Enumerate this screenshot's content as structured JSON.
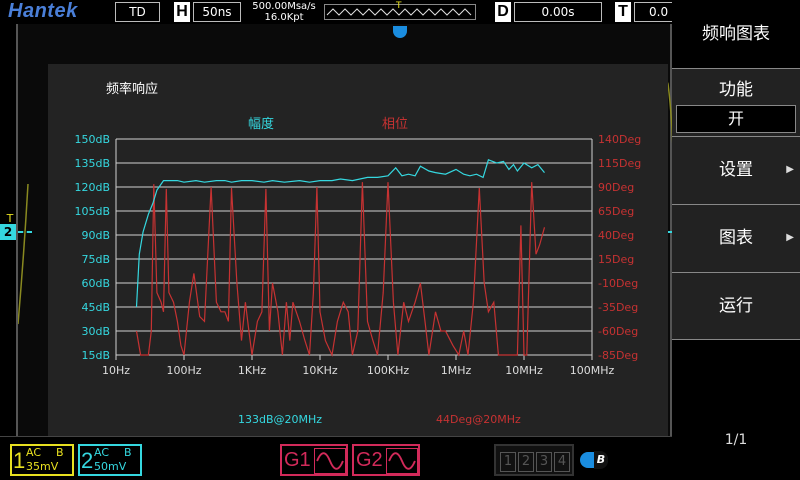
{
  "topbar": {
    "logo": "Hantek",
    "mode": "TD",
    "h_label": "H",
    "timebase": "50ns",
    "sample_rate": "500.00Msa/s",
    "memory": "16.0Kpt",
    "trigger_marker": "T",
    "d_label": "D",
    "delay": "0.00s",
    "t_label": "T",
    "trigger_level": "0.0"
  },
  "menu": {
    "title": "频响图表",
    "function_label": "功能",
    "function_value": "开",
    "settings_label": "设置",
    "chart_label": "图表",
    "run_label": "运行",
    "page": "1/1"
  },
  "trigger_side_label": "T",
  "channel_side_label": "2",
  "colors": {
    "amplitude": "#35d8e0",
    "phase": "#c63232",
    "grid": "#d0d0d0",
    "ch1": "#e8e020",
    "ch2": "#35d8e0",
    "gen": "#d22a5a"
  },
  "chart_data": {
    "type": "line",
    "title": "频率响应",
    "x_scale": "log",
    "x_ticks": [
      "10Hz",
      "100Hz",
      "1KHz",
      "10KHz",
      "100KHz",
      "1MHz",
      "10MHz",
      "100MHz"
    ],
    "xlim": [
      10,
      100000000
    ],
    "y_left_ticks": [
      "150dB",
      "135dB",
      "120dB",
      "105dB",
      "90dB",
      "75dB",
      "60dB",
      "45dB",
      "30dB",
      "15dB"
    ],
    "y_right_ticks": [
      "140Deg",
      "115Deg",
      "90Deg",
      "65Deg",
      "40Deg",
      "15Deg",
      "-10Deg",
      "-35Deg",
      "-60Deg",
      "-85Deg"
    ],
    "y_left_lim": [
      15,
      150
    ],
    "y_right_lim": [
      -85,
      140
    ],
    "grid": true,
    "series": [
      {
        "name": "幅度",
        "axis": "left",
        "x": [
          20,
          22,
          25,
          30,
          35,
          40,
          50,
          60,
          80,
          100,
          150,
          200,
          300,
          400,
          500,
          700,
          1000,
          1500,
          2000,
          3000,
          5000,
          7000,
          10000,
          15000,
          20000,
          30000,
          50000,
          70000,
          100000,
          130000,
          160000,
          200000,
          250000,
          300000,
          400000,
          500000,
          700000,
          1000000,
          1300000,
          1600000,
          2000000,
          2500000,
          3000000,
          4000000,
          5000000,
          6000000,
          7000000,
          8000000,
          10000000,
          13000000,
          16000000,
          20000000
        ],
        "values": [
          45,
          78,
          92,
          103,
          110,
          118,
          124,
          124,
          124,
          123,
          124,
          123,
          124,
          124,
          123,
          124,
          124,
          123,
          124,
          123,
          124,
          123,
          124,
          124,
          125,
          124,
          126,
          126,
          127,
          132,
          127,
          128,
          127,
          133,
          130,
          129,
          128,
          131,
          128,
          127,
          128,
          126,
          137,
          135,
          136,
          131,
          134,
          130,
          135,
          132,
          134,
          129
        ]
      },
      {
        "name": "相位",
        "axis": "right",
        "x": [
          20,
          23,
          26,
          30,
          33,
          36,
          40,
          46,
          50,
          55,
          60,
          70,
          80,
          90,
          100,
          120,
          140,
          170,
          200,
          250,
          300,
          350,
          400,
          450,
          500,
          600,
          700,
          800,
          900,
          1000,
          1200,
          1400,
          1600,
          1800,
          2000,
          2400,
          2800,
          3200,
          3600,
          4000,
          5000,
          6000,
          7000,
          8000,
          9000,
          10000,
          12000,
          15000,
          18000,
          22000,
          26000,
          30000,
          36000,
          42000,
          50000,
          60000,
          70000,
          85000,
          100000,
          120000,
          140000,
          170000,
          200000,
          250000,
          300000,
          350000,
          400000,
          500000,
          600000,
          700000,
          900000,
          1100000,
          1300000,
          1500000,
          1800000,
          2200000,
          2600000,
          3000000,
          3600000,
          4200000,
          5000000,
          6000000,
          7000000,
          8000000,
          9000000,
          10000000,
          11000000,
          13000000,
          15000000,
          17000000,
          20000000
        ],
        "values": [
          -60,
          -85,
          -85,
          -85,
          -60,
          93,
          -20,
          -30,
          -40,
          88,
          -20,
          -30,
          -50,
          -75,
          -85,
          -30,
          0,
          -45,
          -50,
          90,
          -30,
          -40,
          -40,
          -50,
          89,
          -10,
          -70,
          -30,
          -60,
          -85,
          -50,
          -40,
          88,
          -60,
          -10,
          -40,
          -85,
          -30,
          -70,
          -30,
          -50,
          -70,
          -85,
          -20,
          90,
          -40,
          -70,
          -85,
          -50,
          -30,
          -40,
          -85,
          -60,
          95,
          -50,
          -70,
          -85,
          -20,
          95,
          -30,
          -85,
          -30,
          -50,
          -30,
          -10,
          -50,
          -85,
          -40,
          -60,
          -60,
          -75,
          -85,
          -60,
          -85,
          -30,
          89,
          -10,
          -40,
          -30,
          -85,
          -85,
          -85,
          -85,
          -85,
          50,
          -85,
          -85,
          95,
          20,
          30,
          48
        ]
      }
    ],
    "legend": "top-center",
    "readout_amp": "133dB@20MHz",
    "readout_phase": "44Deg@20MHz"
  },
  "bottombar": {
    "ch1_num": "1",
    "ch1_coupling": "AC",
    "ch1_bw": "B",
    "ch1_scale": "35mV",
    "ch2_num": "2",
    "ch2_coupling": "AC",
    "ch2_bw": "B",
    "ch2_scale": "50mV",
    "gen1": "G1",
    "gen2": "G2",
    "dig1": "1",
    "dig2": "2",
    "dig3": "3",
    "dig4": "4",
    "bus_label": "B"
  }
}
